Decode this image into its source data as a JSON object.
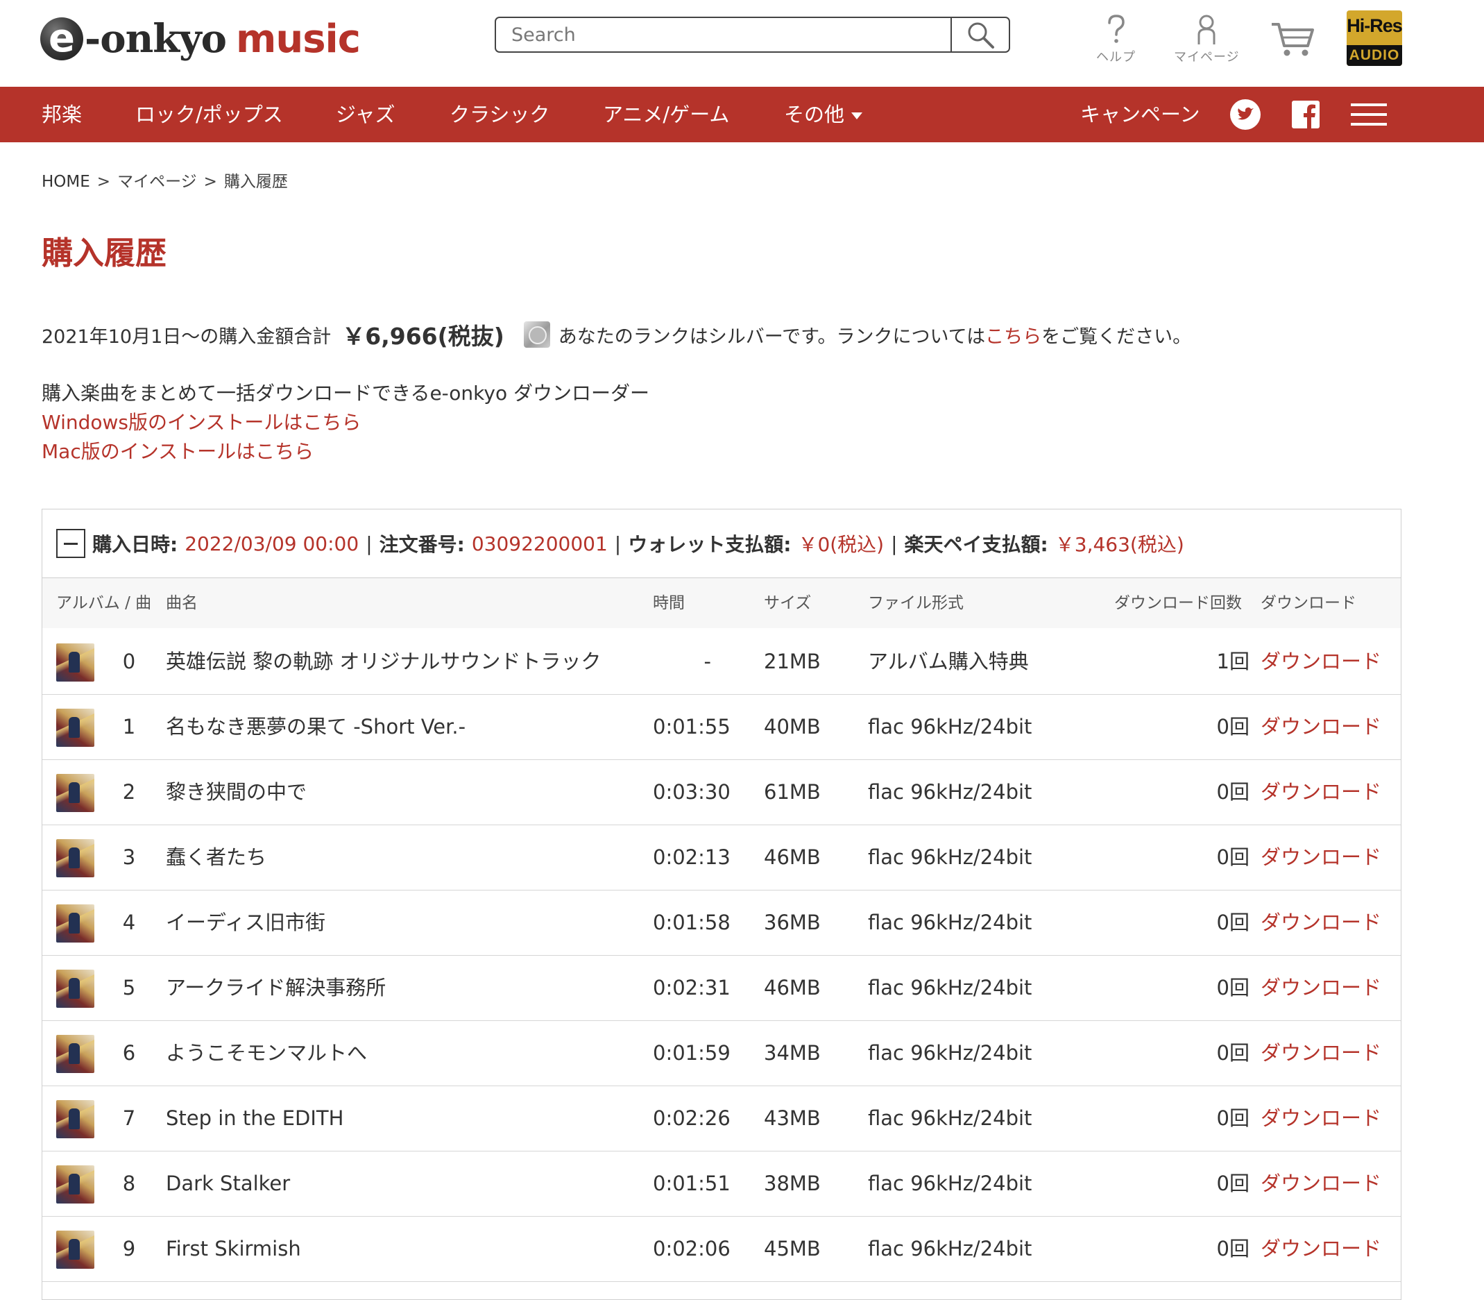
{
  "header": {
    "logo_brand": "-onkyo",
    "logo_e": "e",
    "logo_music": "music",
    "search_placeholder": "Search",
    "help_label": "ヘルプ",
    "mypage_label": "マイページ",
    "hires_line1": "Hi-Res",
    "hires_line2": "AUDIO"
  },
  "nav": {
    "items": [
      "邦楽",
      "ロック/ポップス",
      "ジャズ",
      "クラシック",
      "アニメ/ゲーム",
      "その他"
    ],
    "campaign": "キャンペーン"
  },
  "breadcrumb": [
    "HOME",
    "マイページ",
    "購入履歴"
  ],
  "breadcrumb_sep": ">",
  "page_title": "購入履歴",
  "summary": {
    "prefix": "2021年10月1日～の購入金額合計",
    "amount": "￥6,966(税抜)",
    "rank_text": "あなたのランクはシルバーです。ランクについては",
    "rank_link": "こちら",
    "rank_suffix": "をご覧ください。"
  },
  "downloader": {
    "text": "購入楽曲をまとめて一括ダウンロードできるe-onkyo ダウンローダー",
    "windows_link": "Windows版のインストールはこちら",
    "mac_link": "Mac版のインストールはこちら"
  },
  "order": {
    "date_label": "購入日時:",
    "date_value": "2022/03/09 00:00",
    "order_label": "注文番号:",
    "order_value": "03092200001",
    "wallet_label": "ウォレット支払額:",
    "wallet_value": "￥0(税込)",
    "rakuten_label": "楽天ペイ支払額:",
    "rakuten_value": "￥3,463(税込)",
    "separator": "|",
    "columns": {
      "album_track": "アルバム / 曲",
      "title": "曲名",
      "time": "時間",
      "size": "サイズ",
      "format": "ファイル形式",
      "count": "ダウンロード回数",
      "download": "ダウンロード"
    },
    "rows": [
      {
        "no": "0",
        "title": "英雄伝説 黎の軌跡 オリジナルサウンドトラック",
        "time": "-",
        "size": "21MB",
        "format": "アルバム購入特典",
        "count": "1回",
        "download": "ダウンロード"
      },
      {
        "no": "1",
        "title": "名もなき悪夢の果て -Short Ver.-",
        "time": "0:01:55",
        "size": "40MB",
        "format": "flac 96kHz/24bit",
        "count": "0回",
        "download": "ダウンロード"
      },
      {
        "no": "2",
        "title": "黎き狭間の中で",
        "time": "0:03:30",
        "size": "61MB",
        "format": "flac 96kHz/24bit",
        "count": "0回",
        "download": "ダウンロード"
      },
      {
        "no": "3",
        "title": "蠢く者たち",
        "time": "0:02:13",
        "size": "46MB",
        "format": "flac 96kHz/24bit",
        "count": "0回",
        "download": "ダウンロード"
      },
      {
        "no": "4",
        "title": "イーディス旧市街",
        "time": "0:01:58",
        "size": "36MB",
        "format": "flac 96kHz/24bit",
        "count": "0回",
        "download": "ダウンロード"
      },
      {
        "no": "5",
        "title": "アークライド解決事務所",
        "time": "0:02:31",
        "size": "46MB",
        "format": "flac 96kHz/24bit",
        "count": "0回",
        "download": "ダウンロード"
      },
      {
        "no": "6",
        "title": "ようこそモンマルトへ",
        "time": "0:01:59",
        "size": "34MB",
        "format": "flac 96kHz/24bit",
        "count": "0回",
        "download": "ダウンロード"
      },
      {
        "no": "7",
        "title": "Step in the EDITH",
        "time": "0:02:26",
        "size": "43MB",
        "format": "flac 96kHz/24bit",
        "count": "0回",
        "download": "ダウンロード"
      },
      {
        "no": "8",
        "title": "Dark Stalker",
        "time": "0:01:51",
        "size": "38MB",
        "format": "flac 96kHz/24bit",
        "count": "0回",
        "download": "ダウンロード"
      },
      {
        "no": "9",
        "title": "First Skirmish",
        "time": "0:02:06",
        "size": "45MB",
        "format": "flac 96kHz/24bit",
        "count": "0回",
        "download": "ダウンロード"
      }
    ]
  },
  "colors": {
    "brand_red": "#b5332a",
    "text": "#333333",
    "border": "#cfcfcf",
    "hires_gold": "#d3a72c"
  },
  "icons": [
    "search-icon",
    "help-icon",
    "user-icon",
    "cart-icon",
    "twitter-icon",
    "facebook-icon",
    "menu-icon",
    "collapse-icon",
    "album-thumbnail"
  ]
}
